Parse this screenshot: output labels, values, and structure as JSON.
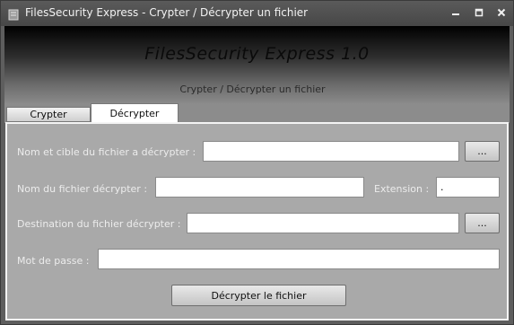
{
  "window": {
    "title": "FilesSecurity Express - Crypter / Décrypter un fichier"
  },
  "header": {
    "app_title": "FilesSecurity Express 1.0",
    "subtitle": "Crypter / Décrypter un fichier"
  },
  "tabs": [
    {
      "label": "Crypter",
      "selected": false
    },
    {
      "label": "Décrypter",
      "selected": true
    }
  ],
  "form": {
    "source_label": "Nom et cible du fichier a décrypter :",
    "source_value": "",
    "source_browse_label": "...",
    "name_label": "Nom du fichier décrypter :",
    "name_value": "",
    "extension_label": "Extension :",
    "extension_value": ".",
    "destination_label": "Destination du fichier décrypter :",
    "destination_value": "",
    "destination_browse_label": "...",
    "password_label": "Mot de passe :",
    "password_value": "",
    "submit_label": "Décrypter le fichier"
  },
  "colors": {
    "panel_bg": "#a9a9a9",
    "titlebar_bg": "#4f4f4f"
  }
}
